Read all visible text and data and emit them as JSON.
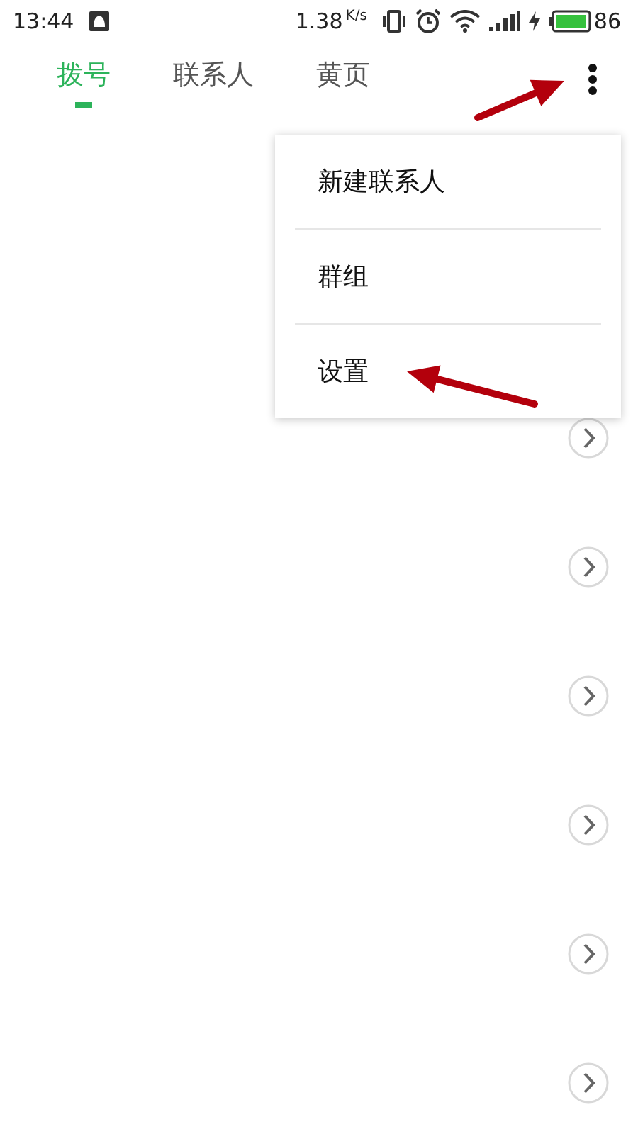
{
  "status_bar": {
    "time": "13:44",
    "speed": "1.38",
    "speed_unit": "K/s",
    "battery": "86"
  },
  "tabs": [
    {
      "label": "拨号",
      "selected": true
    },
    {
      "label": "联系人",
      "selected": false
    },
    {
      "label": "黄页",
      "selected": false
    }
  ],
  "menu": {
    "items": [
      "新建联系人",
      "群组",
      "设置"
    ]
  },
  "rows": [
    {
      "kind": "chevron"
    },
    {
      "kind": "chevron"
    },
    {
      "kind": "chevron"
    },
    {
      "kind": "chevron"
    },
    {
      "kind": "chevron"
    },
    {
      "kind": "chevron"
    }
  ],
  "annotations": [
    {
      "kind": "arrow"
    },
    {
      "kind": "arrow"
    }
  ]
}
